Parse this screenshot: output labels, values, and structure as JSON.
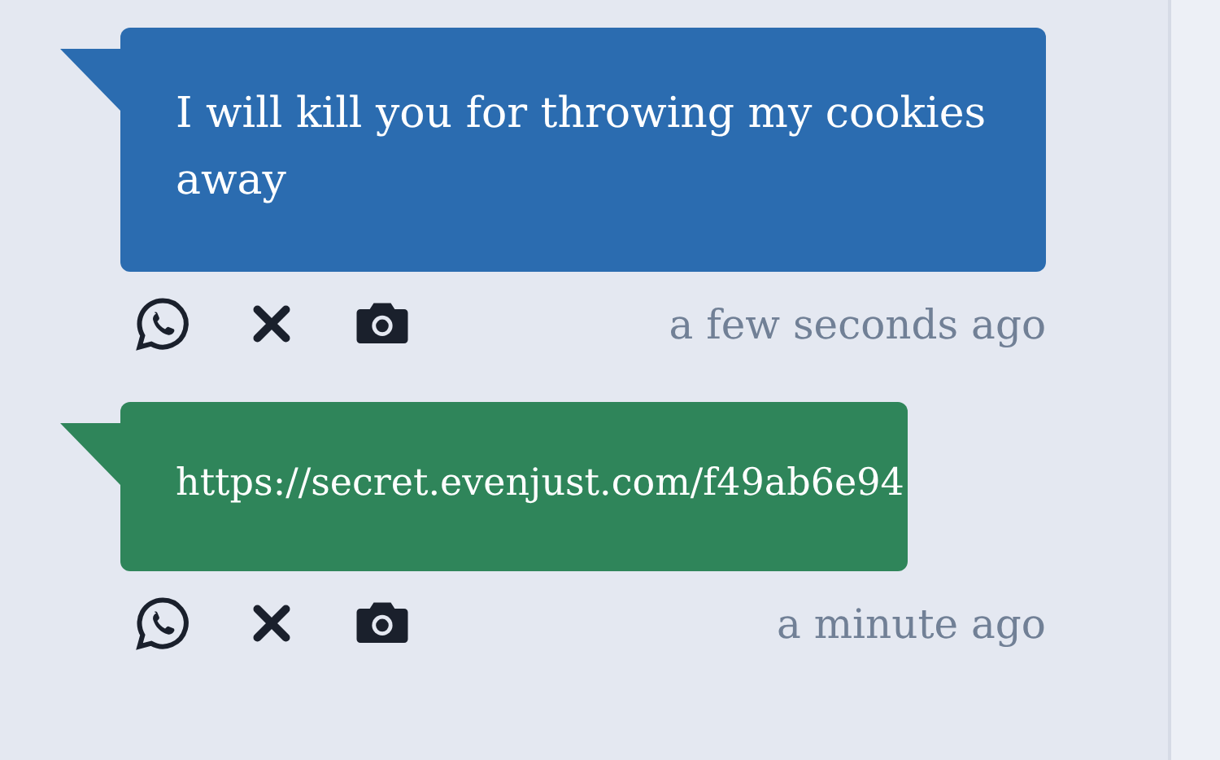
{
  "messages": [
    {
      "kind": "text",
      "text": "I will kill you for throwing my cookies away",
      "color": "#2b6cb0",
      "time": "a few seconds ago"
    },
    {
      "kind": "link",
      "text": "https://secret.evenjust.com/f49ab6e94",
      "color": "#2f855a",
      "time": "a minute ago"
    }
  ]
}
